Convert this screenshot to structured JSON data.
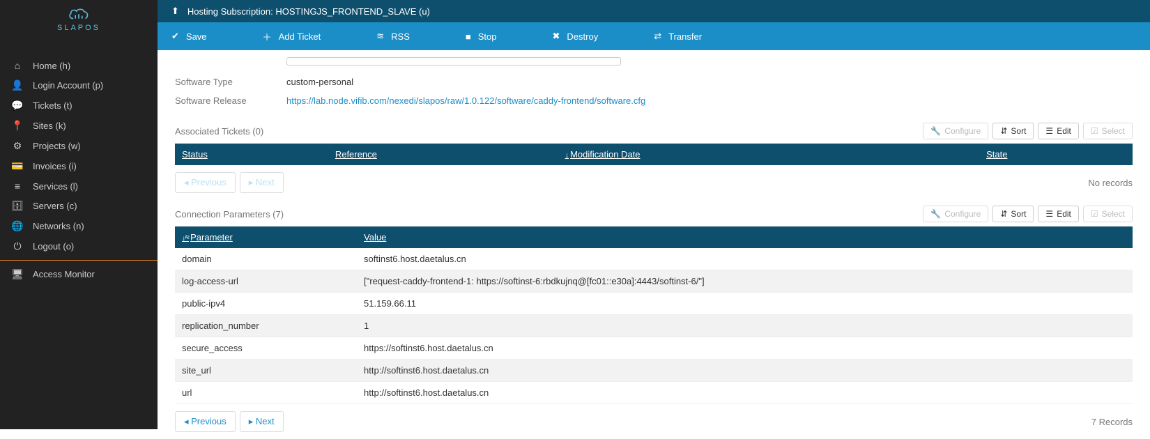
{
  "brand": "SLAPOS",
  "sidebar": {
    "items": [
      {
        "label": "Home (h)",
        "icon": "home"
      },
      {
        "label": "Login Account (p)",
        "icon": "user"
      },
      {
        "label": "Tickets (t)",
        "icon": "comment"
      },
      {
        "label": "Sites (k)",
        "icon": "marker"
      },
      {
        "label": "Projects (w)",
        "icon": "sitemap"
      },
      {
        "label": "Invoices (i)",
        "icon": "card"
      },
      {
        "label": "Services (l)",
        "icon": "bars"
      },
      {
        "label": "Servers (c)",
        "icon": "server"
      },
      {
        "label": "Networks (n)",
        "icon": "globe"
      },
      {
        "label": "Logout (o)",
        "icon": "power"
      }
    ],
    "monitor": "Access Monitor"
  },
  "titlebar": {
    "text": "Hosting Subscription: HOSTINGJS_FRONTEND_SLAVE (u)"
  },
  "actions": {
    "save": "Save",
    "add_ticket": "Add Ticket",
    "rss": "RSS",
    "stop": "Stop",
    "destroy": "Destroy",
    "transfer": "Transfer"
  },
  "fields": {
    "software_type": {
      "label": "Software Type",
      "value": "custom-personal"
    },
    "software_release": {
      "label": "Software Release",
      "value": "https://lab.node.vifib.com/nexedi/slapos/raw/1.0.122/software/caddy-frontend/software.cfg"
    }
  },
  "tickets": {
    "title": "Associated Tickets (0)",
    "columns": {
      "status": "Status",
      "reference": "Reference",
      "mod_date": "Modification Date",
      "state": "State"
    },
    "no_records": "No records",
    "previous": "Previous",
    "next": "Next"
  },
  "params": {
    "title": "Connection Parameters (7)",
    "columns": {
      "parameter": "Parameter",
      "value": "Value"
    },
    "rows": [
      {
        "param": "domain",
        "value": "softinst6.host.daetalus.cn"
      },
      {
        "param": "log-access-url",
        "value": "[\"request-caddy-frontend-1: https://softinst-6:rbdkujnq@[fc01::e30a]:4443/softinst-6/\"]"
      },
      {
        "param": "public-ipv4",
        "value": "51.159.66.11"
      },
      {
        "param": "replication_number",
        "value": "1"
      },
      {
        "param": "secure_access",
        "value": "https://softinst6.host.daetalus.cn"
      },
      {
        "param": "site_url",
        "value": "http://softinst6.host.daetalus.cn"
      },
      {
        "param": "url",
        "value": "http://softinst6.host.daetalus.cn"
      }
    ],
    "records_text": "7 Records",
    "previous": "Previous",
    "next": "Next"
  },
  "controls": {
    "configure": "Configure",
    "sort": "Sort",
    "edit": "Edit",
    "select": "Select"
  }
}
